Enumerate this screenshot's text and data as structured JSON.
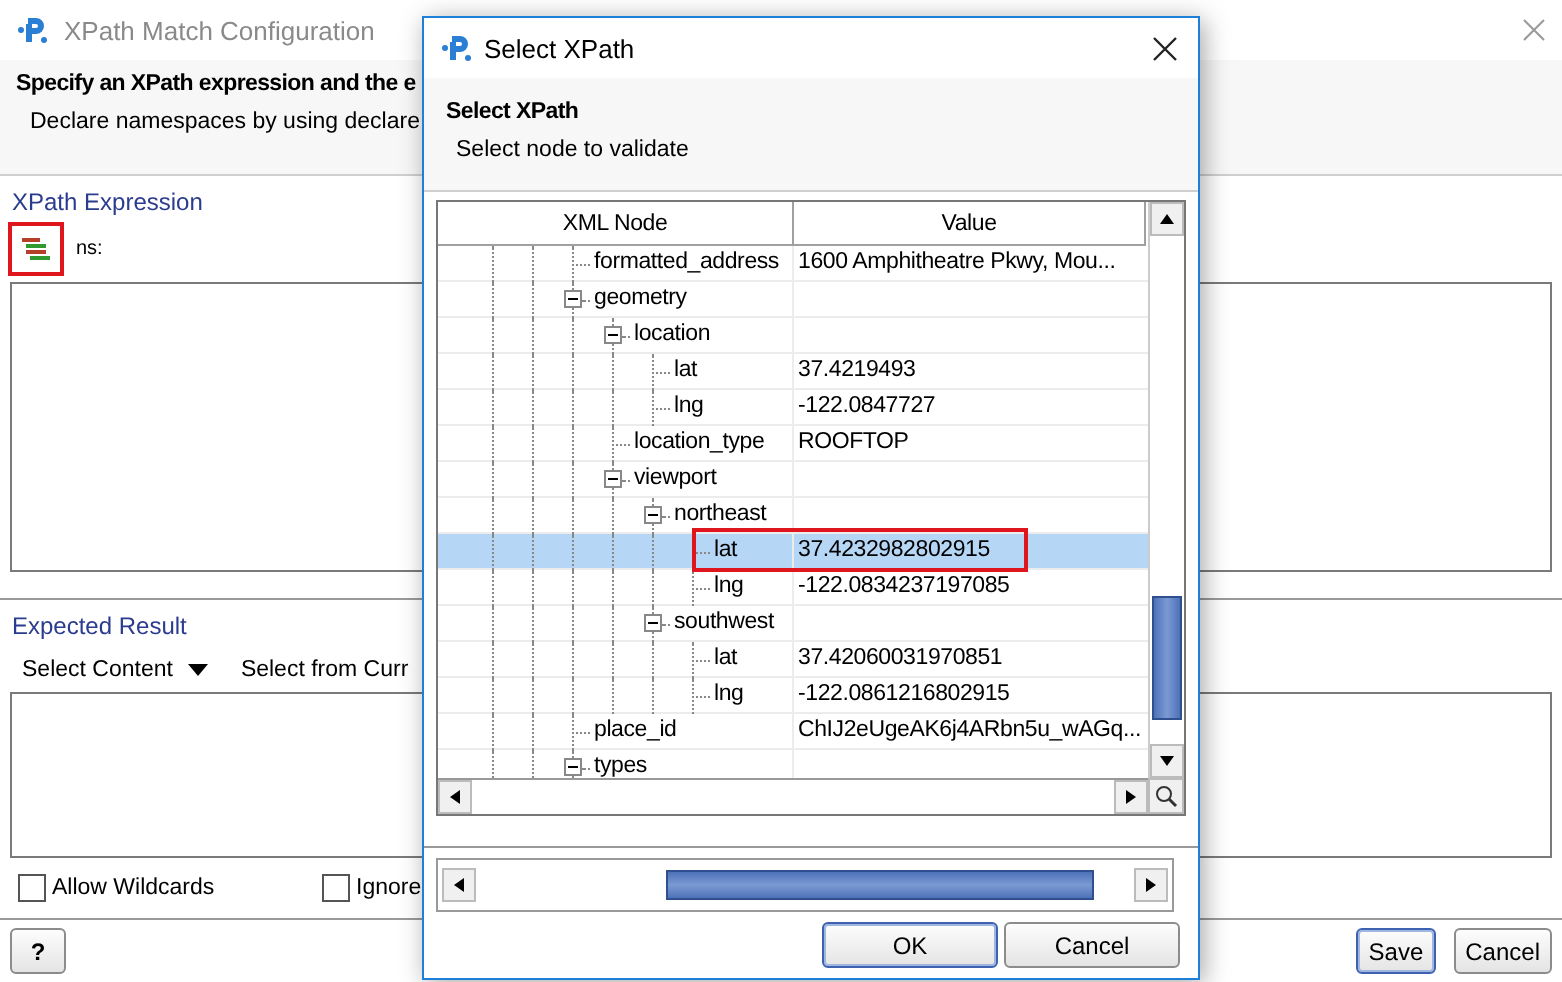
{
  "main_window": {
    "title": "XPath Match Configuration",
    "heading": "Specify an XPath expression and the e",
    "subheading": "Declare namespaces by using declare",
    "xpath_section": {
      "label": "XPath Expression",
      "icon_highlighted": true,
      "ns_label": "ns:"
    },
    "expected_section": {
      "label": "Expected Result",
      "select_content": "Select Content",
      "select_current": "Select from Curr"
    },
    "options": [
      {
        "label": "Allow Wildcards",
        "checked": false
      },
      {
        "label": "Ignore",
        "checked": false
      }
    ],
    "help_button": "?",
    "buttons": [
      "Save",
      "Cancel"
    ]
  },
  "dialog": {
    "title": "Select XPath",
    "heading": "Select XPath",
    "subheading": "Select node to validate",
    "columns": [
      "XML Node",
      "Value"
    ],
    "tree": [
      {
        "name": "formatted_address",
        "value": "1600 Amphitheatre Pkwy, Mou...",
        "selected": false
      },
      {
        "name": "geometry",
        "expanded": true,
        "selected": false,
        "children": [
          {
            "name": "location",
            "expanded": true,
            "selected": false,
            "children": [
              {
                "name": "lat",
                "value": "37.4219493",
                "selected": false
              },
              {
                "name": "lng",
                "value": "-122.0847727",
                "selected": false
              }
            ]
          },
          {
            "name": "location_type",
            "value": "ROOFTOP",
            "selected": false
          },
          {
            "name": "viewport",
            "expanded": true,
            "selected": false,
            "children": [
              {
                "name": "northeast",
                "expanded": true,
                "selected": false,
                "children": [
                  {
                    "name": "lat",
                    "value": "37.4232982802915",
                    "selected": true
                  },
                  {
                    "name": "lng",
                    "value": "-122.0834237197085",
                    "selected": false
                  }
                ]
              },
              {
                "name": "southwest",
                "expanded": true,
                "selected": false,
                "children": [
                  {
                    "name": "lat",
                    "value": "37.42060031970851",
                    "selected": false
                  },
                  {
                    "name": "lng",
                    "value": "-122.0861216802915",
                    "selected": false
                  }
                ]
              }
            ]
          }
        ]
      },
      {
        "name": "place_id",
        "value": "ChIJ2eUgeAK6j4ARbn5u_wAGq...",
        "selected": false
      },
      {
        "name": "types",
        "expanded": true,
        "selected": false
      }
    ],
    "buttons": [
      "OK",
      "Cancel"
    ]
  }
}
